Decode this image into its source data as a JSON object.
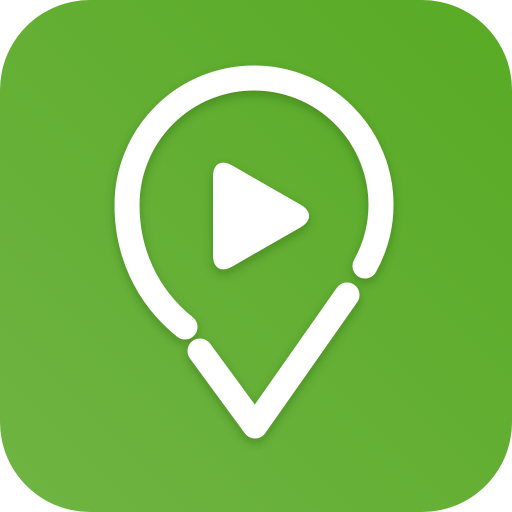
{
  "icon": {
    "name": "map-pin-play-icon",
    "shape": "rounded-square",
    "colors": {
      "gradient_light": "#6fb443",
      "gradient_dark": "#58aa24",
      "glyph": "#ffffff"
    }
  }
}
